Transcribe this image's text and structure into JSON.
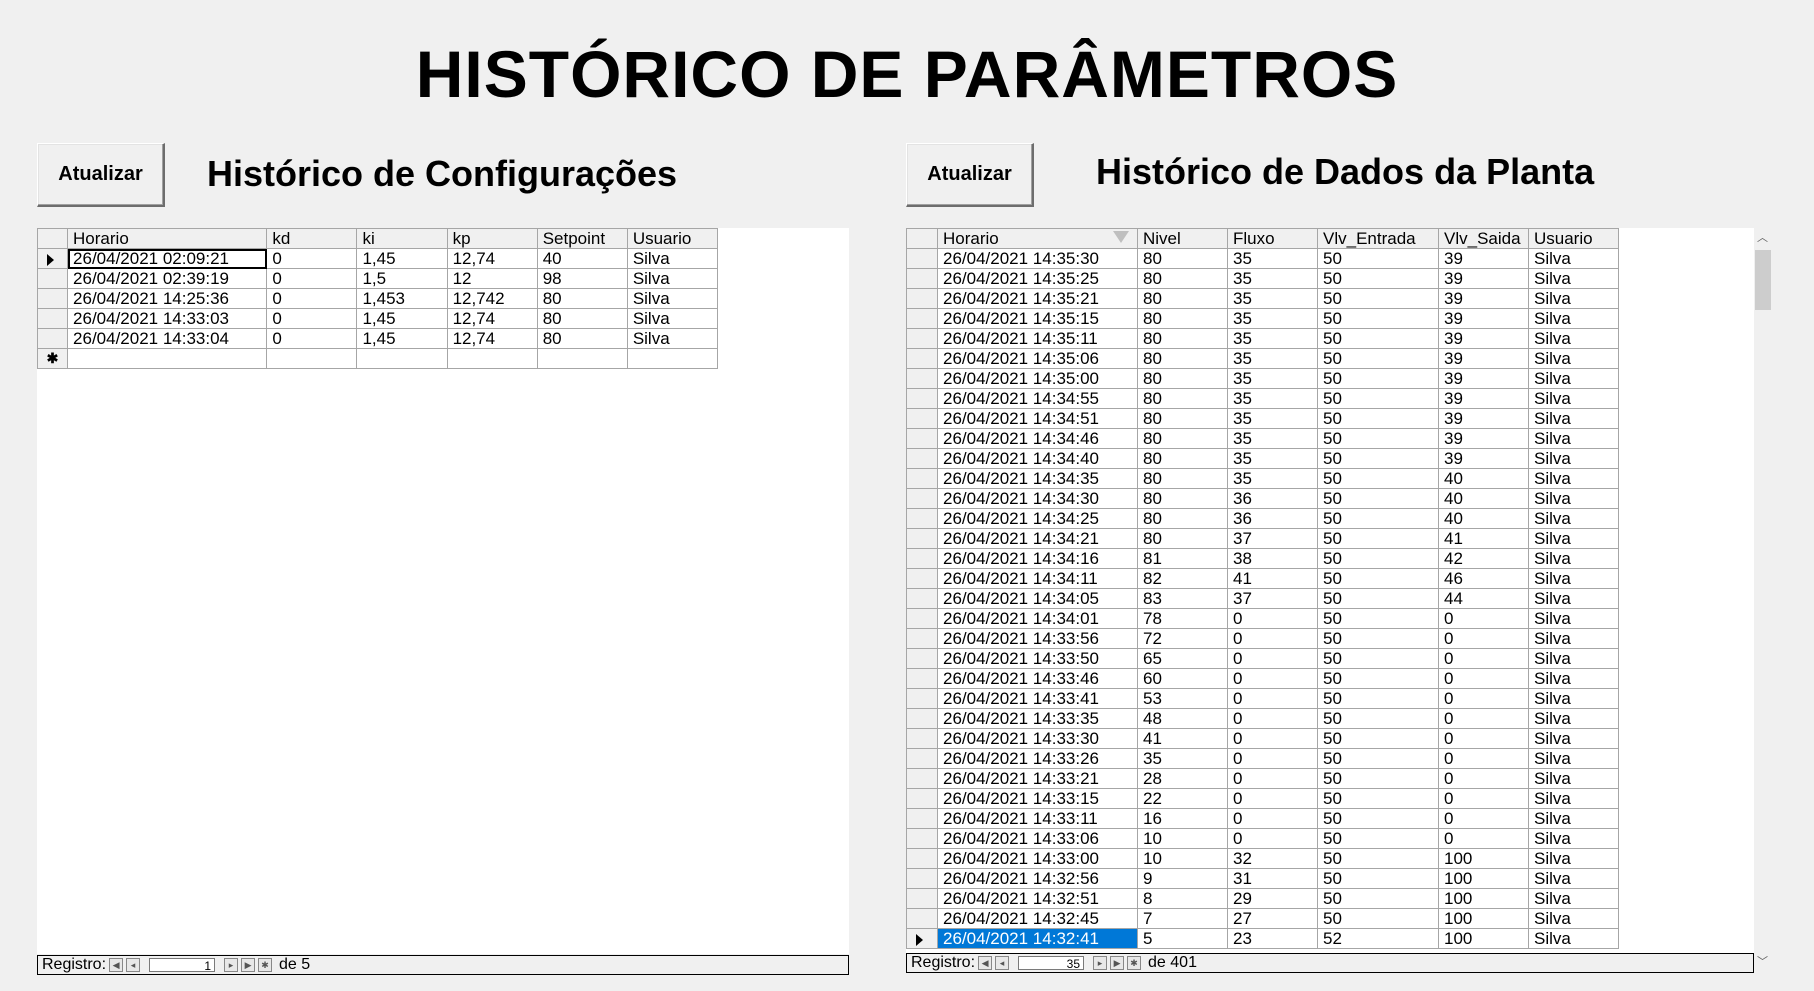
{
  "title": "HISTÓRICO DE PARÂMETROS",
  "config": {
    "refresh_label": "Atualizar",
    "section_title": "Histórico de Configurações",
    "columns": [
      "Horario",
      "kd",
      "ki",
      "kp",
      "Setpoint",
      "Usuario"
    ],
    "rows": [
      [
        "26/04/2021 02:09:21",
        "0",
        "1,45",
        "12,74",
        "40",
        "Silva"
      ],
      [
        "26/04/2021 02:39:19",
        "0",
        "1,5",
        "12",
        "98",
        "Silva"
      ],
      [
        "26/04/2021 14:25:36",
        "0",
        "1,453",
        "12,742",
        "80",
        "Silva"
      ],
      [
        "26/04/2021 14:33:03",
        "0",
        "1,45",
        "12,74",
        "80",
        "Silva"
      ],
      [
        "26/04/2021 14:33:04",
        "0",
        "1,45",
        "12,74",
        "80",
        "Silva"
      ]
    ],
    "current_row": 1,
    "nav": {
      "label": "Registro:",
      "current": "1",
      "total_label": "de 5"
    }
  },
  "plant": {
    "refresh_label": "Atualizar",
    "section_title": "Histórico de Dados da Planta",
    "columns": [
      "Horario",
      "Nivel",
      "Fluxo",
      "Vlv_Entrada",
      "Vlv_Saida",
      "Usuario"
    ],
    "sorted_column": "Horario",
    "rows": [
      [
        "26/04/2021 14:35:30",
        "80",
        "35",
        "50",
        "39",
        "Silva"
      ],
      [
        "26/04/2021 14:35:25",
        "80",
        "35",
        "50",
        "39",
        "Silva"
      ],
      [
        "26/04/2021 14:35:21",
        "80",
        "35",
        "50",
        "39",
        "Silva"
      ],
      [
        "26/04/2021 14:35:15",
        "80",
        "35",
        "50",
        "39",
        "Silva"
      ],
      [
        "26/04/2021 14:35:11",
        "80",
        "35",
        "50",
        "39",
        "Silva"
      ],
      [
        "26/04/2021 14:35:06",
        "80",
        "35",
        "50",
        "39",
        "Silva"
      ],
      [
        "26/04/2021 14:35:00",
        "80",
        "35",
        "50",
        "39",
        "Silva"
      ],
      [
        "26/04/2021 14:34:55",
        "80",
        "35",
        "50",
        "39",
        "Silva"
      ],
      [
        "26/04/2021 14:34:51",
        "80",
        "35",
        "50",
        "39",
        "Silva"
      ],
      [
        "26/04/2021 14:34:46",
        "80",
        "35",
        "50",
        "39",
        "Silva"
      ],
      [
        "26/04/2021 14:34:40",
        "80",
        "35",
        "50",
        "39",
        "Silva"
      ],
      [
        "26/04/2021 14:34:35",
        "80",
        "35",
        "50",
        "40",
        "Silva"
      ],
      [
        "26/04/2021 14:34:30",
        "80",
        "36",
        "50",
        "40",
        "Silva"
      ],
      [
        "26/04/2021 14:34:25",
        "80",
        "36",
        "50",
        "40",
        "Silva"
      ],
      [
        "26/04/2021 14:34:21",
        "80",
        "37",
        "50",
        "41",
        "Silva"
      ],
      [
        "26/04/2021 14:34:16",
        "81",
        "38",
        "50",
        "42",
        "Silva"
      ],
      [
        "26/04/2021 14:34:11",
        "82",
        "41",
        "50",
        "46",
        "Silva"
      ],
      [
        "26/04/2021 14:34:05",
        "83",
        "37",
        "50",
        "44",
        "Silva"
      ],
      [
        "26/04/2021 14:34:01",
        "78",
        "0",
        "50",
        "0",
        "Silva"
      ],
      [
        "26/04/2021 14:33:56",
        "72",
        "0",
        "50",
        "0",
        "Silva"
      ],
      [
        "26/04/2021 14:33:50",
        "65",
        "0",
        "50",
        "0",
        "Silva"
      ],
      [
        "26/04/2021 14:33:46",
        "60",
        "0",
        "50",
        "0",
        "Silva"
      ],
      [
        "26/04/2021 14:33:41",
        "53",
        "0",
        "50",
        "0",
        "Silva"
      ],
      [
        "26/04/2021 14:33:35",
        "48",
        "0",
        "50",
        "0",
        "Silva"
      ],
      [
        "26/04/2021 14:33:30",
        "41",
        "0",
        "50",
        "0",
        "Silva"
      ],
      [
        "26/04/2021 14:33:26",
        "35",
        "0",
        "50",
        "0",
        "Silva"
      ],
      [
        "26/04/2021 14:33:21",
        "28",
        "0",
        "50",
        "0",
        "Silva"
      ],
      [
        "26/04/2021 14:33:15",
        "22",
        "0",
        "50",
        "0",
        "Silva"
      ],
      [
        "26/04/2021 14:33:11",
        "16",
        "0",
        "50",
        "0",
        "Silva"
      ],
      [
        "26/04/2021 14:33:06",
        "10",
        "0",
        "50",
        "0",
        "Silva"
      ],
      [
        "26/04/2021 14:33:00",
        "10",
        "32",
        "50",
        "100",
        "Silva"
      ],
      [
        "26/04/2021 14:32:56",
        "9",
        "31",
        "50",
        "100",
        "Silva"
      ],
      [
        "26/04/2021 14:32:51",
        "8",
        "29",
        "50",
        "100",
        "Silva"
      ],
      [
        "26/04/2021 14:32:45",
        "7",
        "27",
        "50",
        "100",
        "Silva"
      ],
      [
        "26/04/2021 14:32:41",
        "5",
        "23",
        "52",
        "100",
        "Silva"
      ]
    ],
    "current_row": 35,
    "nav": {
      "label": "Registro:",
      "current": "35",
      "total_label": "de 401"
    }
  },
  "icons": {
    "record_selector": "triangle-right-icon",
    "new_record": "asterisk-icon",
    "nav_first": "first-record-icon",
    "nav_prev": "previous-record-icon",
    "nav_next": "next-record-icon",
    "nav_last": "last-record-icon",
    "nav_new": "new-record-icon",
    "scroll_up": "chevron-up-icon",
    "scroll_down": "chevron-down-icon",
    "sort": "sort-descending-icon"
  },
  "colors": {
    "background": "#f0f0f0",
    "selection": "#0078d7",
    "grid_line": "#a6a6a6"
  }
}
